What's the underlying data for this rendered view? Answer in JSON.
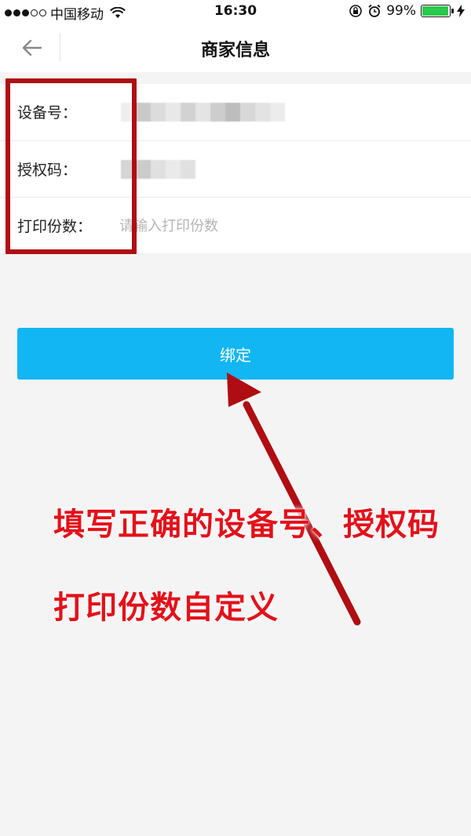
{
  "status_bar": {
    "carrier": "中国移动",
    "time": "16:30",
    "battery_percent": "99%",
    "battery_level": 0.99,
    "icons": [
      "signal-dots-icon",
      "wifi-icon",
      "rotation-lock-icon",
      "alarm-icon",
      "battery-icon",
      "charging-icon"
    ]
  },
  "nav": {
    "title": "商家信息",
    "back_icon": "arrow-left-icon"
  },
  "form": {
    "rows": [
      {
        "label": "设备号：",
        "value_masked": true
      },
      {
        "label": "授权码：",
        "value_masked": true
      },
      {
        "label": "打印份数：",
        "value": "",
        "placeholder": "请输入打印份数"
      }
    ]
  },
  "bind_button": {
    "label": "绑定"
  },
  "annotation": {
    "line1": "填写正确的设备号、授权码",
    "line2": "打印份数自定义",
    "color": "#e3111a",
    "box_color": "#b00d12"
  },
  "colors": {
    "accent": "#12b6f3",
    "background": "#f4f4f4",
    "battery": "#2dc84d"
  }
}
